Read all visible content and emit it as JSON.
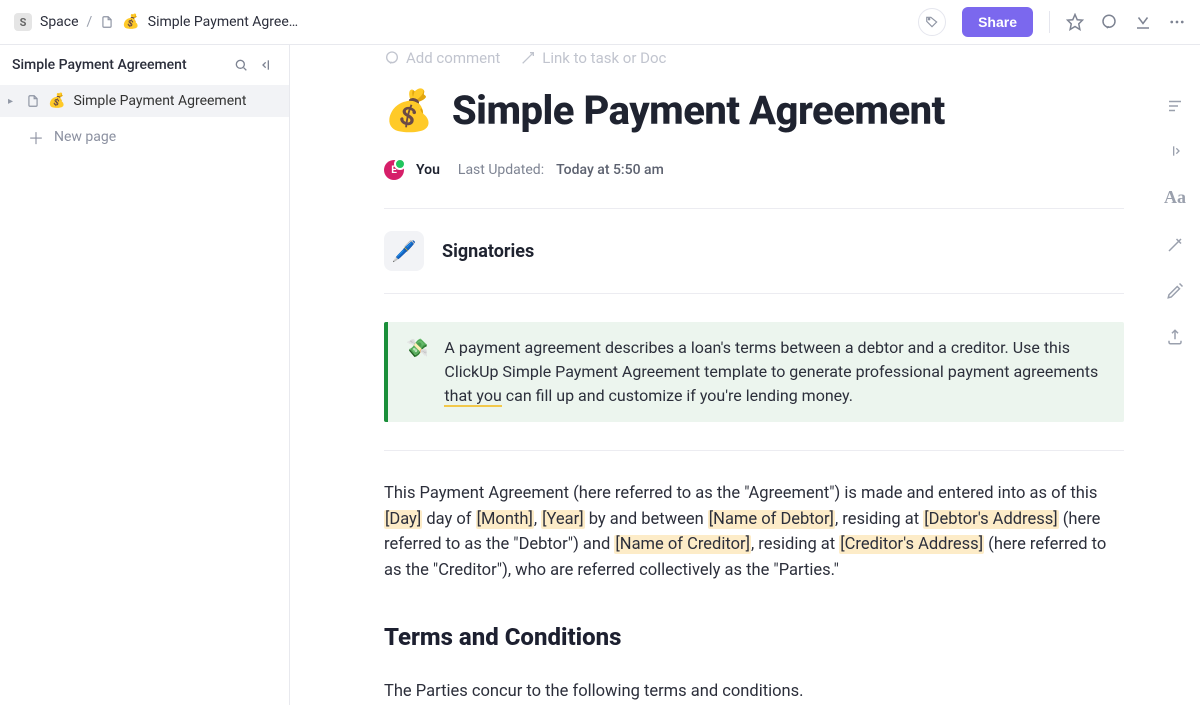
{
  "breadcrumb": {
    "space_initial": "S",
    "space_label": "Space",
    "doc_emoji": "💰",
    "doc_label": "Simple Payment Agree…"
  },
  "topbar": {
    "share_label": "Share"
  },
  "sidebar": {
    "title": "Simple Payment Agreement",
    "items": [
      {
        "emoji": "💰",
        "label": "Simple Payment Agreement",
        "active": true
      }
    ],
    "new_page_label": "New page"
  },
  "ghost_toolbar": {
    "add_comment": "Add comment",
    "link_task": "Link to task or Doc"
  },
  "document": {
    "title_emoji": "💰",
    "title": "Simple Payment Agreement",
    "author_initial": "E",
    "author_you": "You",
    "last_updated_label": "Last Updated:",
    "last_updated_value": "Today at 5:50 am",
    "signatories": {
      "chip_emoji": "🖊️",
      "label": "Signatories"
    },
    "callout": {
      "emoji": "💸",
      "text_before": "A payment agreement describes a loan's terms between a debtor and a creditor. Use this ClickUp Simple Payment Agreement template to generate professional payment agreements ",
      "text_underlined": "that you",
      "text_after": " can fill up and customize if you're lending money."
    },
    "intro": {
      "a": "This Payment Agreement (here referred to as the \"Agreement\") is made and entered into as of this ",
      "day": "[Day]",
      "b": " day of ",
      "month": "[Month]",
      "c": ", ",
      "year": "[Year]",
      "d": " by and between ",
      "debtor_name": "[Name of Debtor]",
      "e": ", residing at ",
      "debtor_addr": "[Debtor's Address]",
      "f": " (here referred to as the \"Debtor\") and ",
      "creditor_name": "[Name of Creditor]",
      "g": ", residing at ",
      "creditor_addr": "[Creditor's Address]",
      "h": " (here referred to as the \"Creditor\"), who are referred collectively as the \"Parties.\""
    },
    "terms_heading": "Terms and Conditions",
    "terms_intro": "The Parties concur to the following terms and conditions."
  }
}
